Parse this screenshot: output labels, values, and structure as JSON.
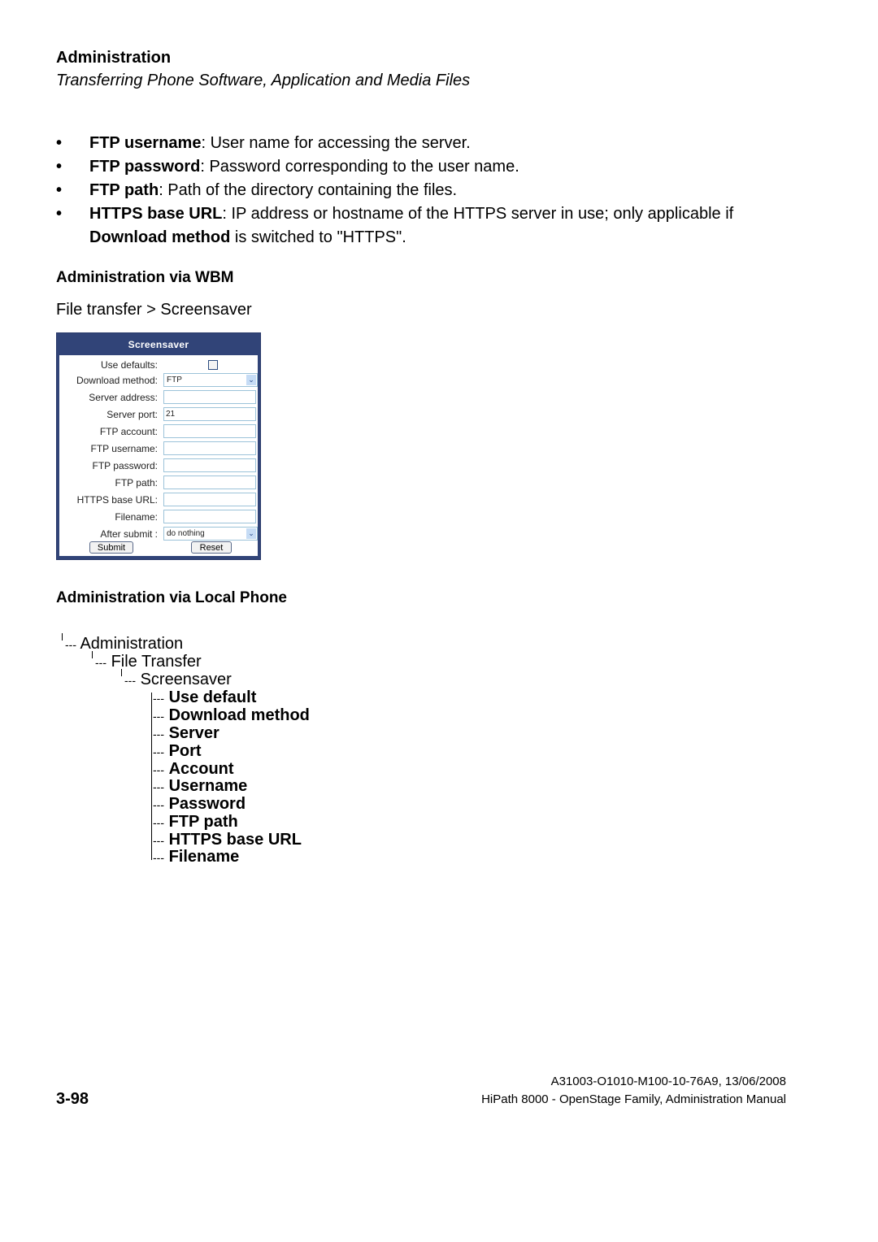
{
  "header": {
    "chapter": "Administration",
    "subtitle": "Transferring Phone Software, Application and Media Files"
  },
  "bullets": [
    {
      "term": "FTP username",
      "text": ": User name for accessing the server."
    },
    {
      "term": "FTP password",
      "text": ": Password corresponding to the user name."
    },
    {
      "term": "FTP path",
      "text": ": Path of the directory containing the files."
    },
    {
      "term": "HTTPS base URL",
      "text": ": IP address or hostname of the HTTPS server in use; only applicable if",
      "term2": "Download method",
      "text2": " is switched to \"HTTPS\"."
    }
  ],
  "bullet_glyph": "•",
  "wbm": {
    "heading": "Administration via WBM",
    "path": "File transfer > Screensaver",
    "form": {
      "title": "Screensaver",
      "fields": [
        {
          "label": "Use defaults:",
          "type": "checkbox",
          "checked": false
        },
        {
          "label": "Download method:",
          "type": "select",
          "value": "FTP"
        },
        {
          "label": "Server address:",
          "type": "text",
          "value": ""
        },
        {
          "label": "Server port:",
          "type": "text",
          "value": "21"
        },
        {
          "label": "FTP account:",
          "type": "text",
          "value": ""
        },
        {
          "label": "FTP username:",
          "type": "text",
          "value": ""
        },
        {
          "label": "FTP password:",
          "type": "text",
          "value": ""
        },
        {
          "label": "FTP path:",
          "type": "text",
          "value": ""
        },
        {
          "label": "HTTPS base URL:",
          "type": "text",
          "value": ""
        },
        {
          "label": "Filename:",
          "type": "text",
          "value": ""
        },
        {
          "label": "After submit :",
          "type": "select",
          "value": "do nothing"
        }
      ],
      "submit_label": "Submit",
      "reset_label": "Reset",
      "colors": {
        "header_bg": "#314478",
        "input_border": "#9cc3d9"
      }
    }
  },
  "local": {
    "heading": "Administration via Local Phone",
    "tree": [
      {
        "connector": "---",
        "label": "Administration"
      },
      {
        "connector": "---",
        "label": "File Transfer"
      },
      {
        "connector": "---",
        "label": "Screensaver"
      }
    ],
    "items": [
      {
        "connector": "---",
        "label": "Use default"
      },
      {
        "connector": "---",
        "label": "Download method"
      },
      {
        "connector": "---",
        "label": "Server"
      },
      {
        "connector": "---",
        "label": "Port"
      },
      {
        "connector": "---",
        "label": "Account"
      },
      {
        "connector": "---",
        "label": "Username"
      },
      {
        "connector": "---",
        "label": "Password"
      },
      {
        "connector": "---",
        "label": "FTP path"
      },
      {
        "connector": "---",
        "label": "HTTPS base URL"
      },
      {
        "connector": "---",
        "label": "Filename"
      }
    ]
  },
  "footer": {
    "page_number": "3-98",
    "doc_id": "A31003-O1010-M100-10-76A9, 13/06/2008",
    "doc_title": "HiPath 8000 - OpenStage Family, Administration Manual"
  }
}
